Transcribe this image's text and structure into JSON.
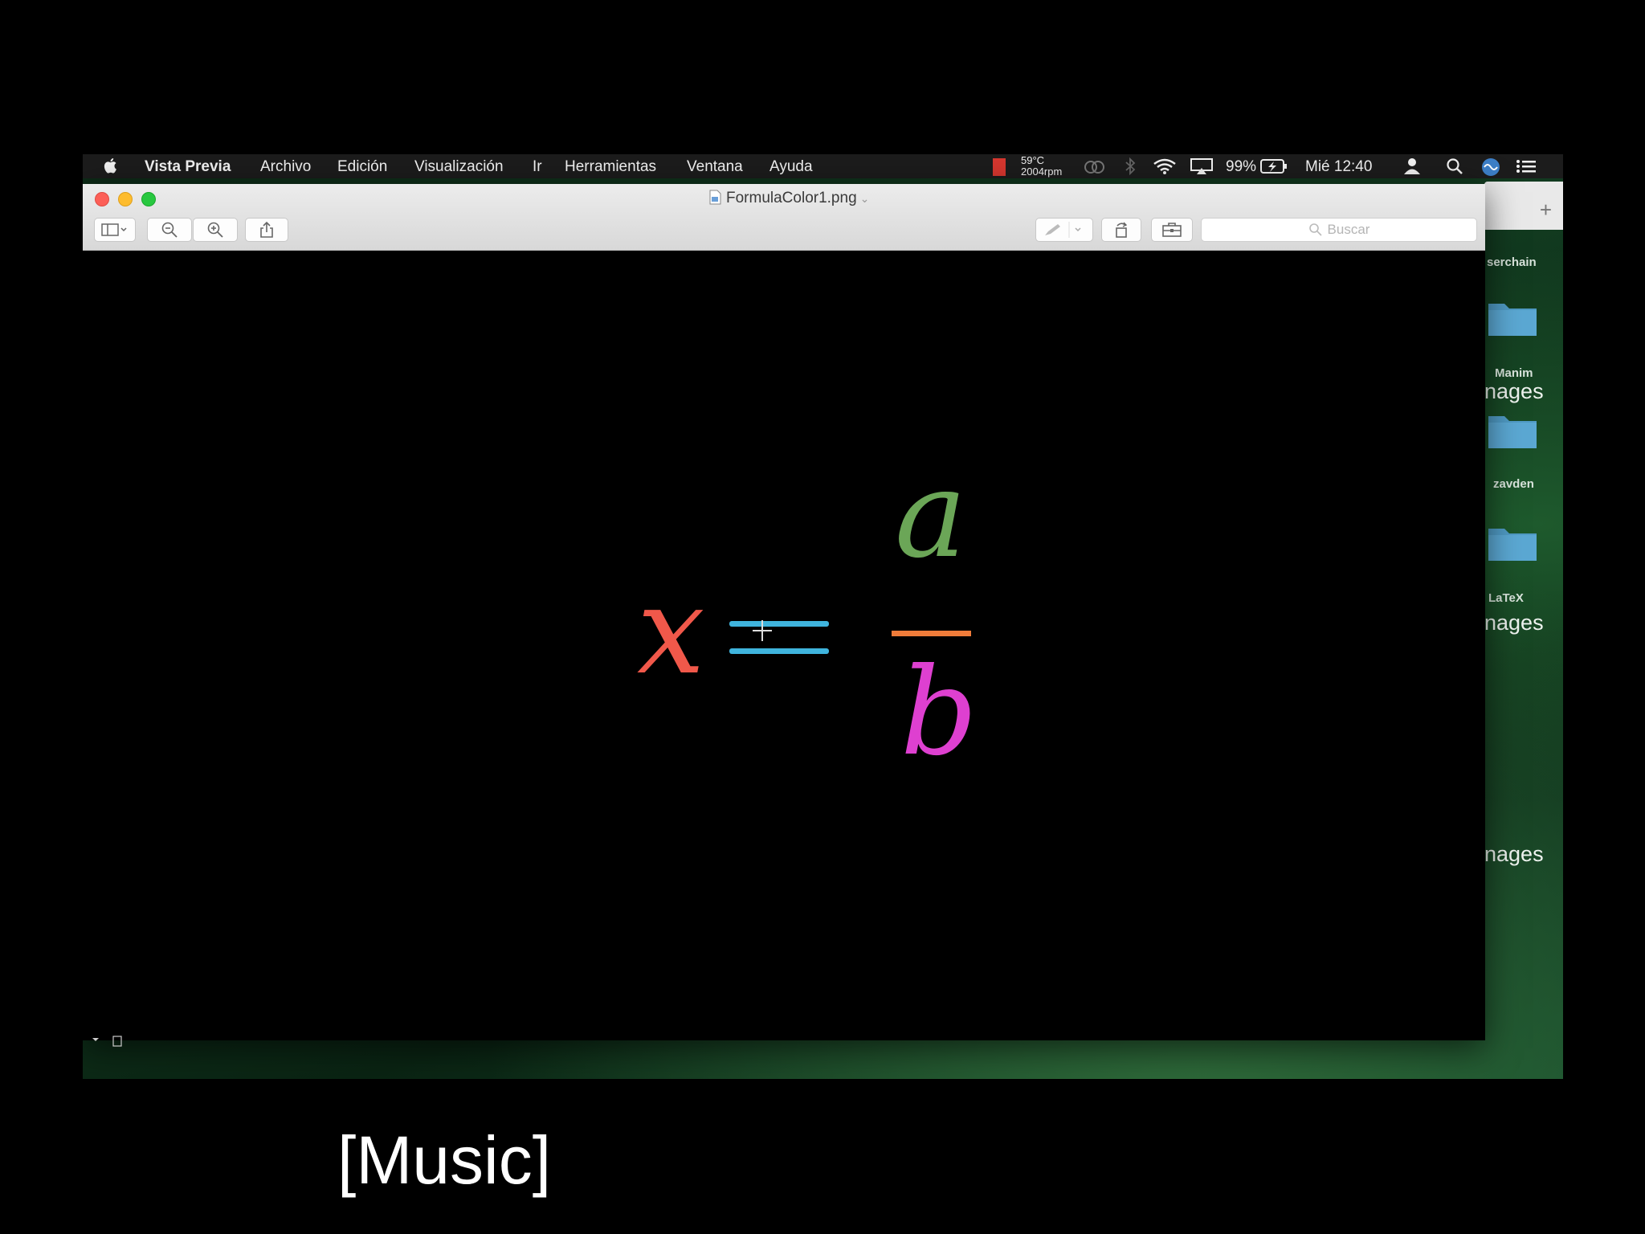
{
  "menubar": {
    "app_name": "Vista Previa",
    "items": [
      "Archivo",
      "Edición",
      "Visualización",
      "Ir",
      "Herramientas",
      "Ventana",
      "Ayuda"
    ],
    "temp": "59°C",
    "rpm": "2004rpm",
    "battery": "99%",
    "clock": "Mié 12:40"
  },
  "window": {
    "title": "FormulaColor1.png",
    "search_placeholder": "Buscar"
  },
  "formula": {
    "lhs": "x",
    "equals": "=",
    "numerator": "a",
    "denominator": "b",
    "colors": {
      "lhs": "#f0584a",
      "equals": "#3fb4dd",
      "numerator": "#6ba657",
      "fraction_bar": "#f07c3a",
      "denominator": "#de40d0"
    }
  },
  "desktop": {
    "labels": [
      "serchain",
      "Manim",
      "zavden",
      "LaTeX"
    ],
    "big_labels": [
      "nages",
      "nages",
      "nages"
    ]
  },
  "caption": "[Music]"
}
